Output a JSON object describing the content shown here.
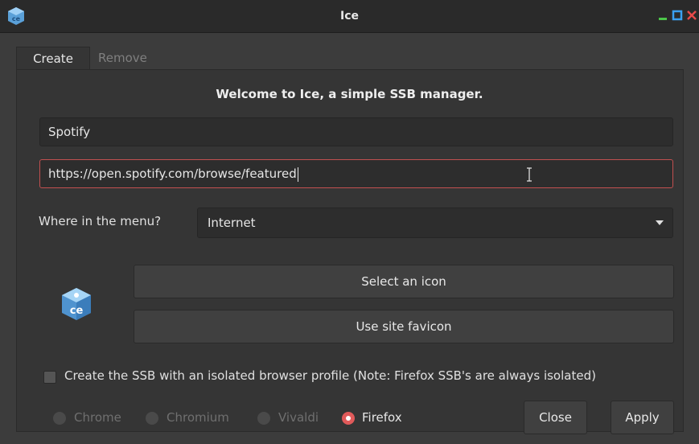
{
  "window": {
    "title": "Ice",
    "icon": "ice-app-icon",
    "controls": [
      "minimize-icon",
      "maximize-icon",
      "close-icon"
    ]
  },
  "tabs": [
    {
      "label": "Create",
      "active": true
    },
    {
      "label": "Remove",
      "active": false
    }
  ],
  "create": {
    "welcome": "Welcome to Ice, a simple SSB manager.",
    "name_value": "Spotify",
    "url_value": "https://open.spotify.com/browse/featured",
    "menu_label": "Where in the menu?",
    "menu_selected": "Internet",
    "select_icon_label": "Select an icon",
    "favicon_label": "Use site favicon",
    "isolated_label": "Create the SSB with an isolated browser profile (Note: Firefox SSB's are always isolated)",
    "isolated_checked": false,
    "browsers": [
      {
        "label": "Chrome",
        "selected": false,
        "enabled": false
      },
      {
        "label": "Chromium",
        "selected": false,
        "enabled": false
      },
      {
        "label": "Vivaldi",
        "selected": false,
        "enabled": false
      },
      {
        "label": "Firefox",
        "selected": true,
        "enabled": true
      }
    ],
    "close_label": "Close",
    "apply_label": "Apply"
  },
  "colors": {
    "accent": "#e05a5a",
    "focus_border": "#c25050",
    "background": "#353535"
  }
}
